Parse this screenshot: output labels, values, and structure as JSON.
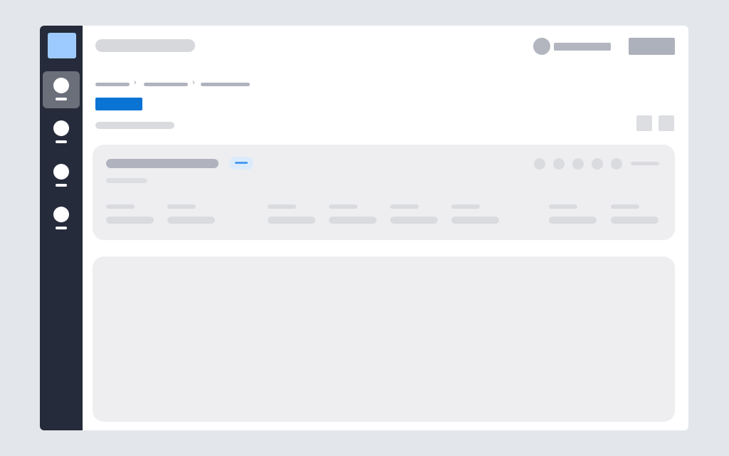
{
  "app": {
    "title": "",
    "colors": {
      "page_background": "#e3e6ea",
      "sidebar": "#252b3a",
      "logo": "#9ecbff",
      "primary_accent": "#0a74d4",
      "badge_fill": "#dcebfb",
      "badge_accent": "#4a9cf0",
      "card_background": "#eeeef0"
    }
  },
  "sidebar": {
    "logo_icon": "app-logo-icon",
    "items": [
      {
        "icon": "nav-icon",
        "state": "active"
      },
      {
        "icon": "nav-icon",
        "state": "inactive"
      },
      {
        "icon": "nav-icon",
        "state": "inactive"
      },
      {
        "icon": "nav-icon",
        "state": "inactive"
      }
    ]
  },
  "header": {
    "search": {
      "state": "placeholder-skeleton"
    },
    "user": {
      "avatar_icon": "avatar-icon"
    },
    "actions": [
      {
        "type": "button"
      }
    ]
  },
  "breadcrumb": {
    "separator": "›",
    "items": [
      {
        "level": 1
      },
      {
        "level": 2
      },
      {
        "level": 3
      }
    ]
  },
  "toolbar": {
    "primary_action": {
      "type": "button"
    },
    "icon_buttons": [
      {
        "type": "icon-button"
      },
      {
        "type": "icon-button"
      }
    ]
  },
  "summary_card": {
    "status_indicators": 5,
    "fields": 8
  },
  "content_panel": {
    "state": "empty"
  }
}
